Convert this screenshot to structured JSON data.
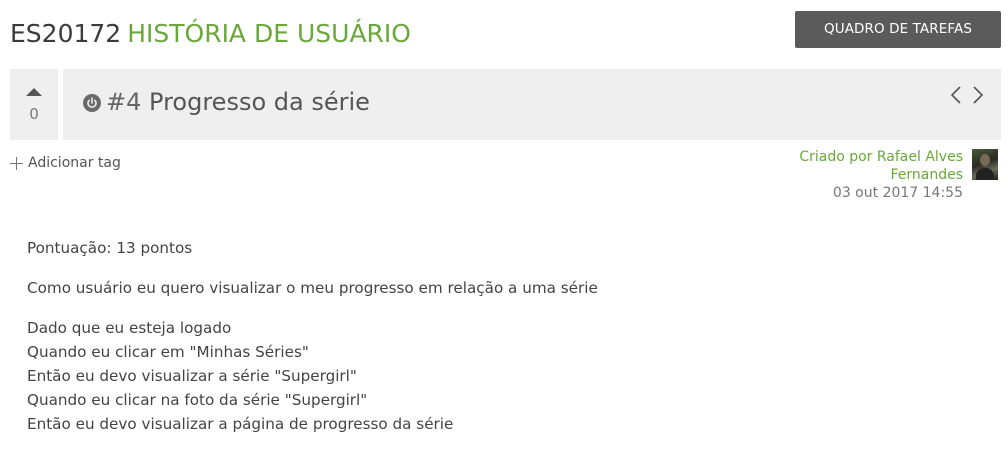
{
  "header": {
    "project_code": "ES20172",
    "section_title": "HISTÓRIA DE USUÁRIO",
    "taskboard_button": "QUADRO DE TAREFAS"
  },
  "story": {
    "votes": "0",
    "ref": "#4",
    "title": "Progresso da série",
    "status_icon": "power-icon",
    "nav_prev_icon": "chevron-left-icon",
    "nav_next_icon": "chevron-right-icon"
  },
  "tags": {
    "add_label": "Adicionar tag"
  },
  "creator": {
    "label": "Criado por Rafael Alves Fernandes",
    "date": "03 out 2017 14:55"
  },
  "description": {
    "points": "Pontuação: 13 pontos",
    "statement": "Como usuário eu quero visualizar o meu progresso em relação a uma série",
    "scenario": [
      "Dado que eu esteja logado",
      "Quando eu clicar em \"Minhas Séries\"",
      "Então eu devo visualizar a série \"Supergirl\"",
      "Quando eu clicar na foto da série \"Supergirl\"",
      "Então eu devo visualizar a página de progresso da série"
    ]
  },
  "colors": {
    "accent_green": "#6aa839",
    "button_dark": "#5b5b5b",
    "panel_gray": "#efefef"
  }
}
